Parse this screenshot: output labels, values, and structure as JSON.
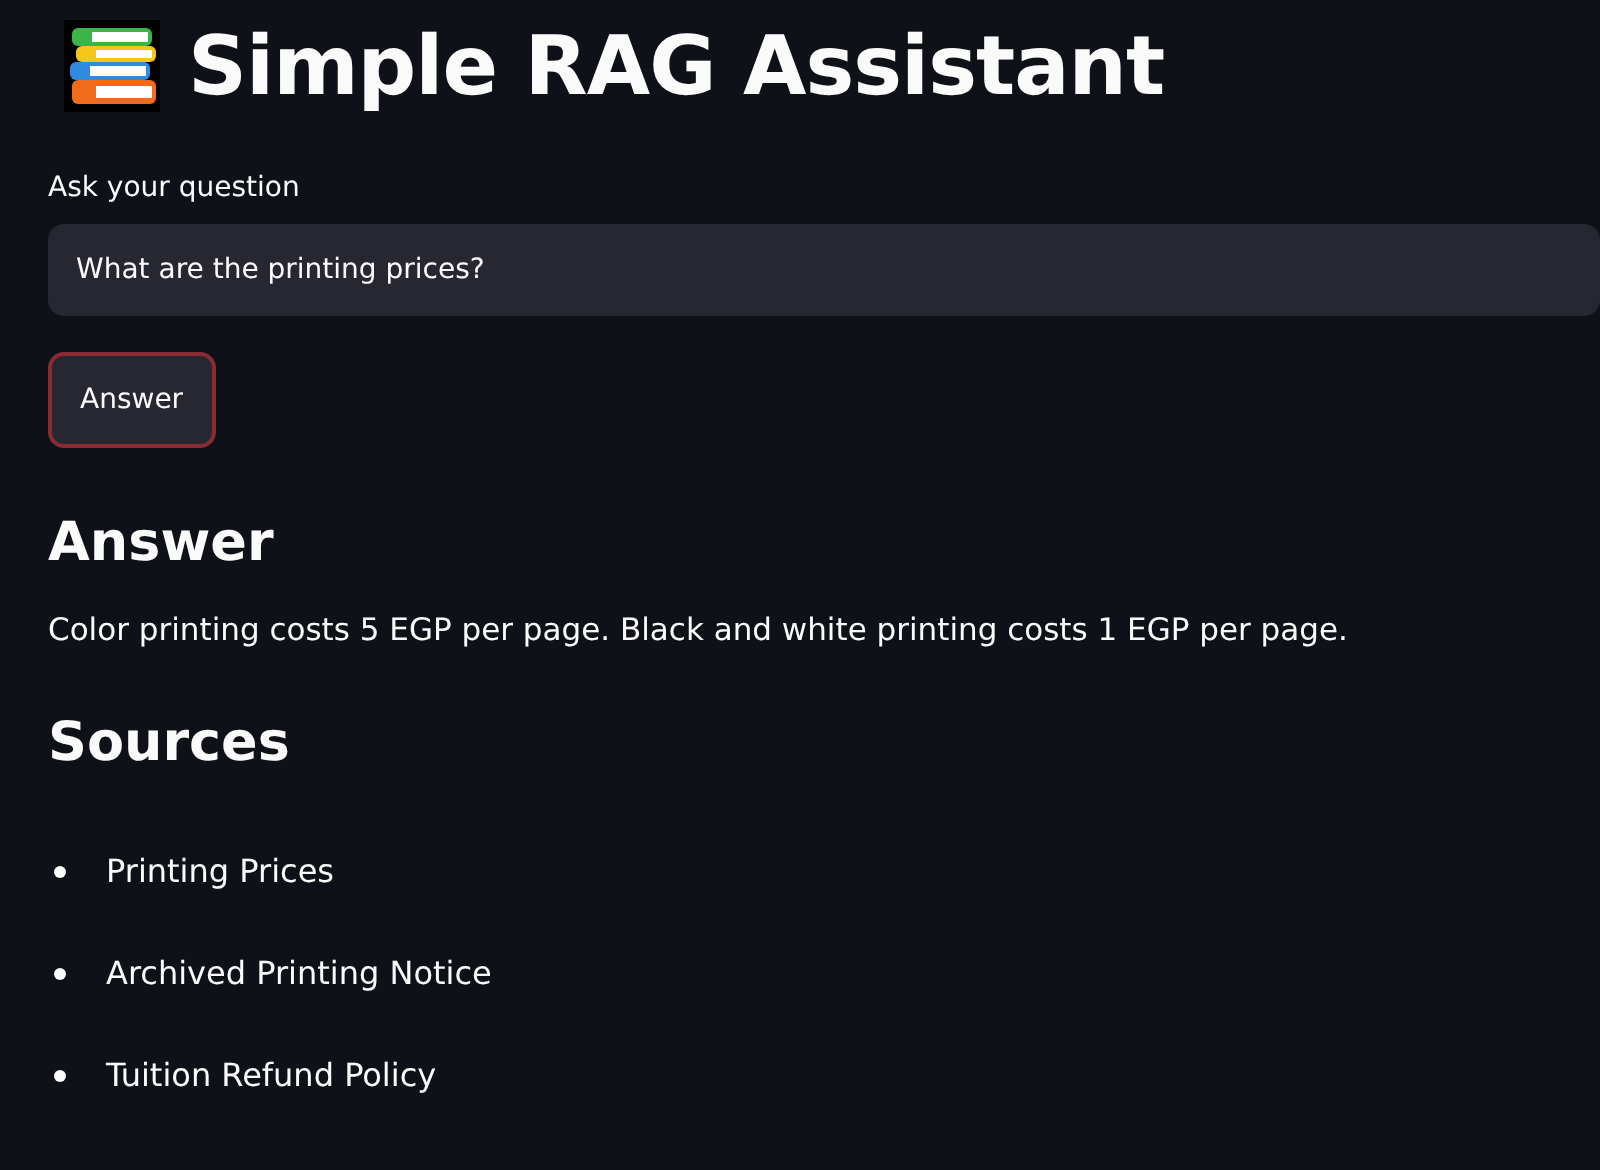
{
  "title": "Simple RAG Assistant",
  "question": {
    "label": "Ask your question",
    "value": "What are the printing prices?"
  },
  "answer_button": {
    "label": "Answer",
    "focused": true
  },
  "answer": {
    "heading": "Answer",
    "text": "Color printing costs 5 EGP per page. Black and white printing costs 1 EGP per page."
  },
  "sources": {
    "heading": "Sources",
    "items": [
      {
        "label": "Printing Prices"
      },
      {
        "label": "Archived Printing Notice"
      },
      {
        "label": "Tuition Refund Policy"
      }
    ]
  }
}
